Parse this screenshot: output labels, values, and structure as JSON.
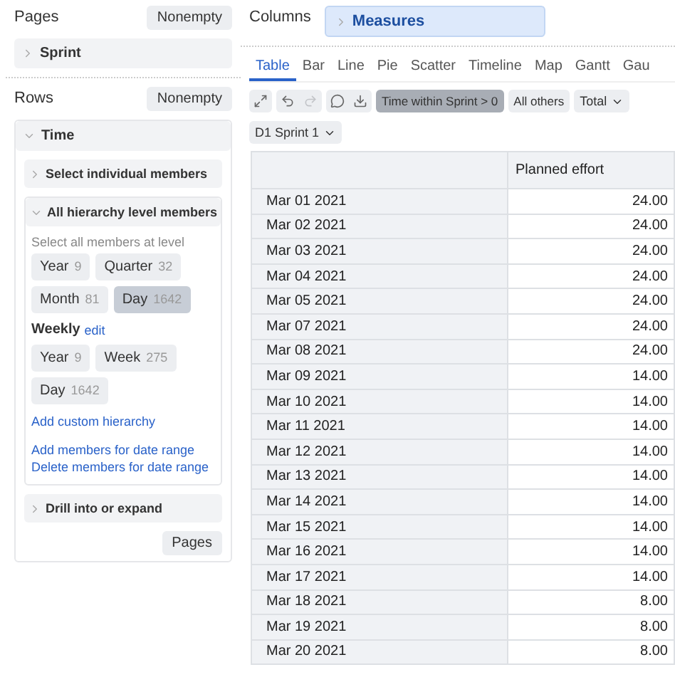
{
  "pages": {
    "title": "Pages",
    "button": "Nonempty",
    "items": [
      {
        "label": "Sprint",
        "expanded": false
      }
    ]
  },
  "rows": {
    "title": "Rows",
    "button": "Nonempty",
    "dimension": {
      "label": "Time",
      "expanded": true,
      "select_individual": {
        "label": "Select individual members",
        "expanded": false
      },
      "hierarchy": {
        "label": "All hierarchy level members",
        "expanded": true,
        "hint": "Select all members at level",
        "levels": [
          {
            "label": "Year",
            "count": "9",
            "selected": false
          },
          {
            "label": "Quarter",
            "count": "32",
            "selected": false
          },
          {
            "label": "Month",
            "count": "81",
            "selected": false
          },
          {
            "label": "Day",
            "count": "1642",
            "selected": true
          }
        ],
        "custom": {
          "name": "Weekly",
          "link": "edit",
          "levels": [
            {
              "label": "Year",
              "count": "9",
              "selected": false
            },
            {
              "label": "Week",
              "count": "275",
              "selected": false
            },
            {
              "label": "Day",
              "count": "1642",
              "selected": false
            }
          ]
        },
        "add_link": "Add custom hierarchy",
        "range_links": [
          "Add members for date range",
          "Delete members for date range"
        ]
      },
      "drill": {
        "label": "Drill into or expand",
        "expanded": false
      },
      "footer_button": "Pages"
    }
  },
  "columns": {
    "title": "Columns",
    "items": [
      {
        "label": "Measures",
        "expanded": false
      }
    ]
  },
  "tabs": [
    {
      "label": "Table",
      "selected": true
    },
    {
      "label": "Bar",
      "selected": false
    },
    {
      "label": "Line",
      "selected": false
    },
    {
      "label": "Pie",
      "selected": false
    },
    {
      "label": "Scatter",
      "selected": false
    },
    {
      "label": "Timeline",
      "selected": false
    },
    {
      "label": "Map",
      "selected": false
    },
    {
      "label": "Gantt",
      "selected": false
    },
    {
      "label": "Gau",
      "selected": false
    }
  ],
  "tool_groups": [
    [
      {
        "kind": "expand",
        "disabled": false
      }
    ],
    [
      {
        "kind": "undo",
        "disabled": false
      },
      {
        "kind": "redo",
        "disabled": true
      }
    ],
    [
      {
        "kind": "comment",
        "disabled": false
      },
      {
        "kind": "export",
        "disabled": false
      }
    ]
  ],
  "filters": [
    {
      "label": "Time within Sprint > 0",
      "selected": true
    },
    {
      "label": "All others",
      "selected": false
    }
  ],
  "total_dropdown": "Total",
  "page_selector": "D1 Sprint 1",
  "table": {
    "column": "Planned effort",
    "rows": [
      {
        "label": "Mar 01 2021",
        "value": "24.00"
      },
      {
        "label": "Mar 02 2021",
        "value": "24.00"
      },
      {
        "label": "Mar 03 2021",
        "value": "24.00"
      },
      {
        "label": "Mar 04 2021",
        "value": "24.00"
      },
      {
        "label": "Mar 05 2021",
        "value": "24.00"
      },
      {
        "label": "Mar 07 2021",
        "value": "24.00"
      },
      {
        "label": "Mar 08 2021",
        "value": "24.00"
      },
      {
        "label": "Mar 09 2021",
        "value": "14.00"
      },
      {
        "label": "Mar 10 2021",
        "value": "14.00"
      },
      {
        "label": "Mar 11 2021",
        "value": "14.00"
      },
      {
        "label": "Mar 12 2021",
        "value": "14.00"
      },
      {
        "label": "Mar 13 2021",
        "value": "14.00"
      },
      {
        "label": "Mar 14 2021",
        "value": "14.00"
      },
      {
        "label": "Mar 15 2021",
        "value": "14.00"
      },
      {
        "label": "Mar 16 2021",
        "value": "14.00"
      },
      {
        "label": "Mar 17 2021",
        "value": "14.00"
      },
      {
        "label": "Mar 18 2021",
        "value": "8.00"
      },
      {
        "label": "Mar 19 2021",
        "value": "8.00"
      },
      {
        "label": "Mar 20 2021",
        "value": "8.00"
      }
    ]
  }
}
